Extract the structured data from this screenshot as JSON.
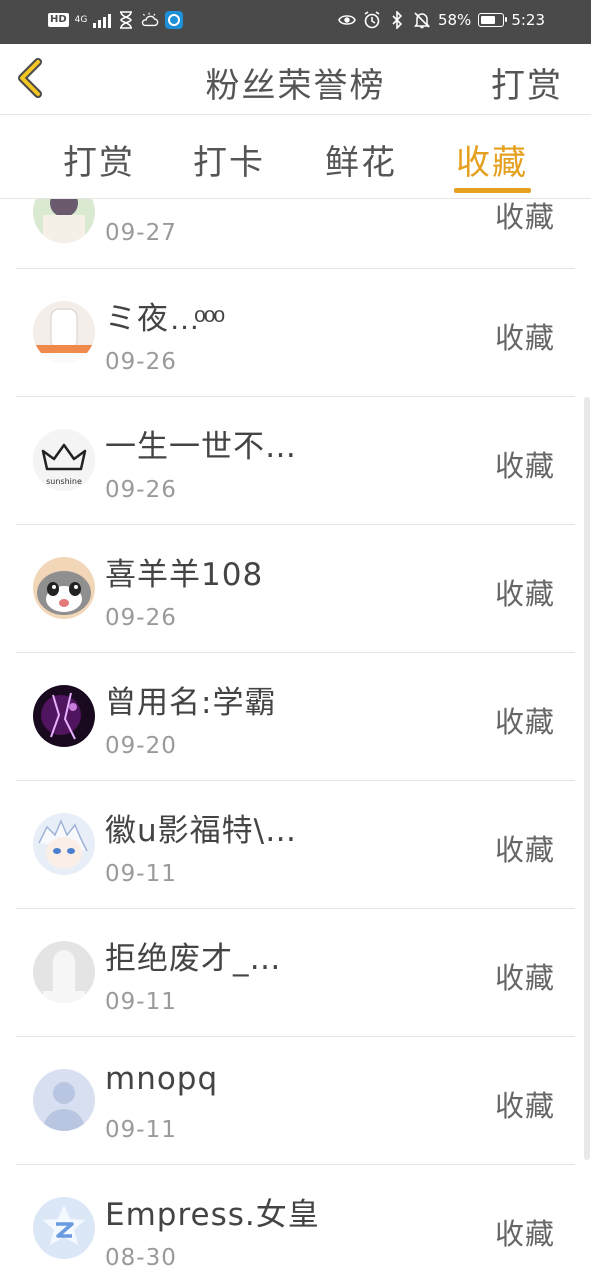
{
  "status_bar": {
    "hd": "HD",
    "network": "4G",
    "battery": "58%",
    "time": "5:23"
  },
  "header": {
    "title": "粉丝荣誉榜",
    "right_action": "打赏"
  },
  "tabs": [
    {
      "label": "打赏",
      "active": false
    },
    {
      "label": "打卡",
      "active": false
    },
    {
      "label": "鲜花",
      "active": false
    },
    {
      "label": "收藏",
      "active": true
    }
  ],
  "fans": [
    {
      "name": "",
      "date": "09-27",
      "action": "收藏"
    },
    {
      "name": "ミ夜…ͦ ͦ ͦ",
      "date": "09-26",
      "action": "收藏"
    },
    {
      "name": "一生一世不…",
      "date": "09-26",
      "action": "收藏"
    },
    {
      "name": "喜羊羊108",
      "date": "09-26",
      "action": "收藏"
    },
    {
      "name": "曾用名:学霸",
      "date": "09-20",
      "action": "收藏"
    },
    {
      "name": "徽u影福特\\…",
      "date": "09-11",
      "action": "收藏"
    },
    {
      "name": "拒绝废才_…",
      "date": "09-11",
      "action": "收藏"
    },
    {
      "name": "mnopq",
      "date": "09-11",
      "action": "收藏"
    },
    {
      "name": "Empress.女皇",
      "date": "08-30",
      "action": "收藏"
    }
  ],
  "avatar_texts": {
    "crown_caption": "sunshine"
  },
  "colors": {
    "accent": "#e6a01f",
    "status_bar": "#4a4a4a"
  }
}
